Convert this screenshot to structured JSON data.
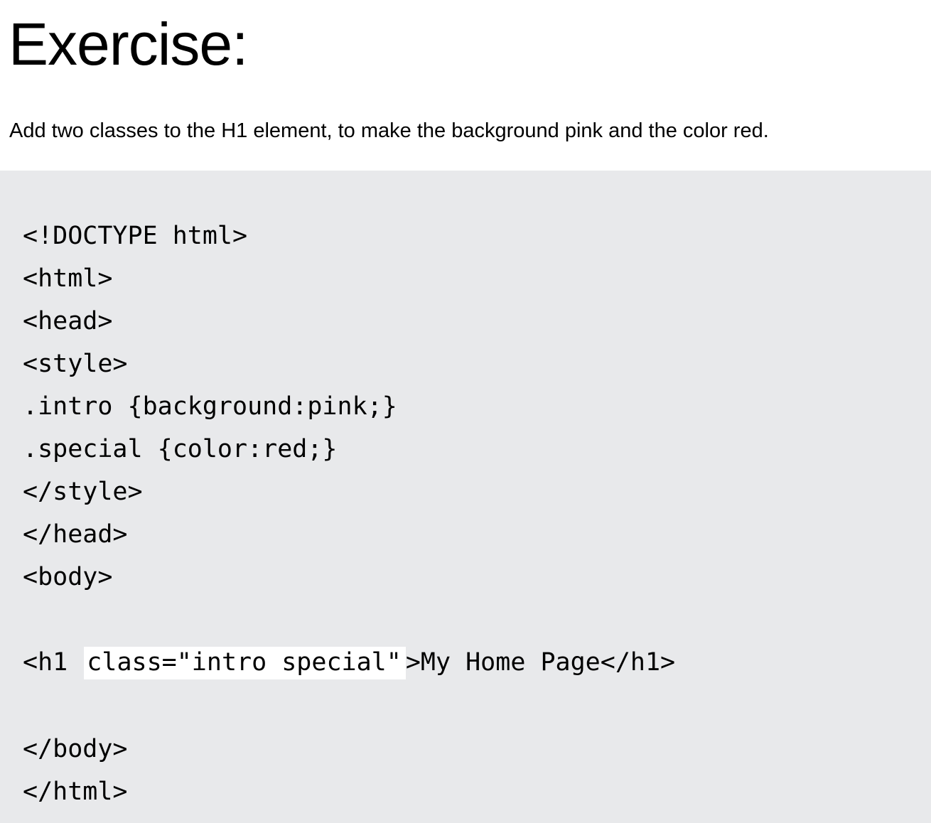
{
  "exercise": {
    "title": "Exercise:",
    "instruction": "Add two classes to the H1 element, to make the background pink and the color red."
  },
  "code": {
    "lines": [
      "<!DOCTYPE html>",
      "<html>",
      "<head>",
      "<style>",
      ".intro {background:pink;}",
      ".special {color:red;}",
      "</style>",
      "</head>",
      "<body>"
    ],
    "h1_prefix": "<h1",
    "h1_answer": "class=\"intro special\"",
    "h1_suffix": ">My Home Page</h1>",
    "closing_lines": [
      "</body>",
      "</html>"
    ]
  },
  "colors": {
    "code_background": "#e8e9eb",
    "answer_field_background": "#ffffff"
  }
}
